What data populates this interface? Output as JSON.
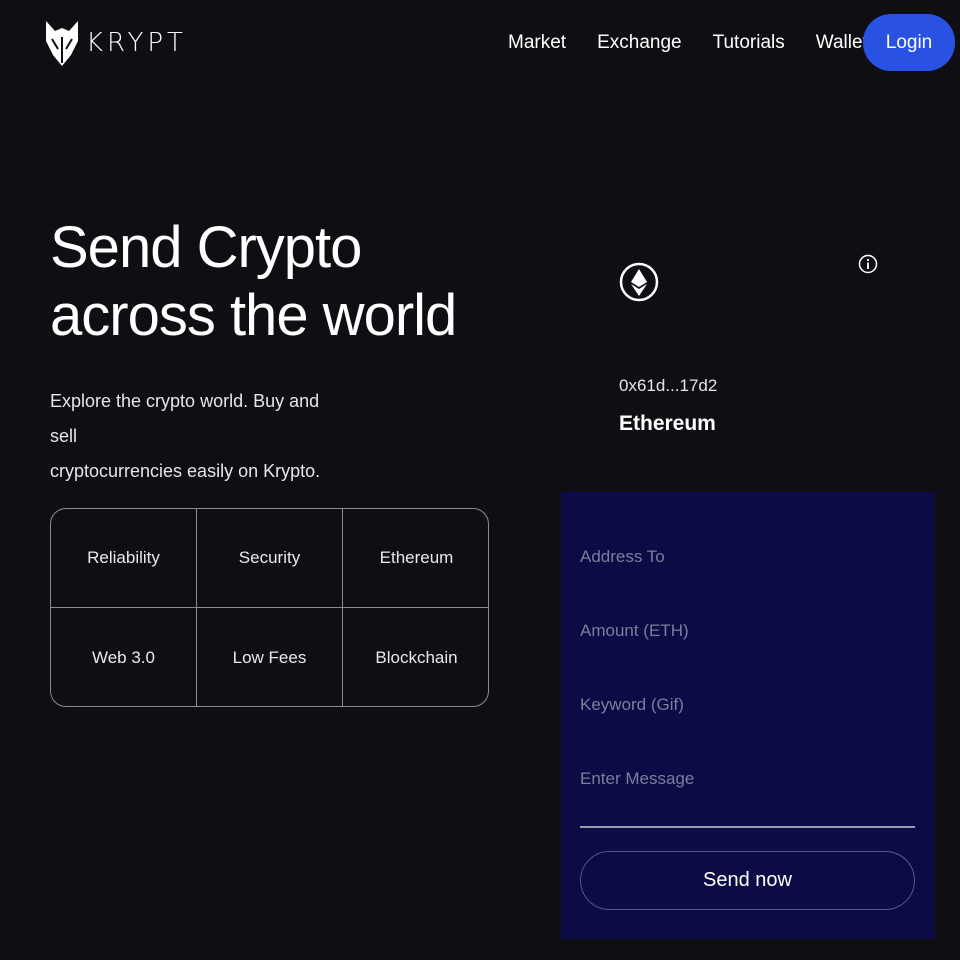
{
  "brand": {
    "name": "KRYPT",
    "logo_icon": "fox-head-icon"
  },
  "nav": {
    "links": [
      "Market",
      "Exchange",
      "Tutorials",
      "Wallets"
    ],
    "login_label": "Login"
  },
  "hero": {
    "title_line1": "Send Crypto",
    "title_line2": "across the world",
    "subtitle_line1": "Explore the crypto world. Buy and sell",
    "subtitle_line2": "cryptocurrencies easily on Krypto."
  },
  "features": [
    "Reliability",
    "Security",
    "Ethereum",
    "Web 3.0",
    "Low Fees",
    "Blockchain"
  ],
  "card": {
    "logo_icon": "ethereum-icon",
    "info_icon": "info-icon",
    "address": "0x61d...17d2",
    "network": "Ethereum"
  },
  "form": {
    "address_placeholder": "Address To",
    "amount_placeholder": "Amount (ETH)",
    "keyword_placeholder": "Keyword (Gif)",
    "message_placeholder": "Enter Message",
    "send_label": "Send now"
  },
  "colors": {
    "background": "#0f0f13",
    "accent": "#2952e3",
    "form_background": "#0b0b45"
  }
}
